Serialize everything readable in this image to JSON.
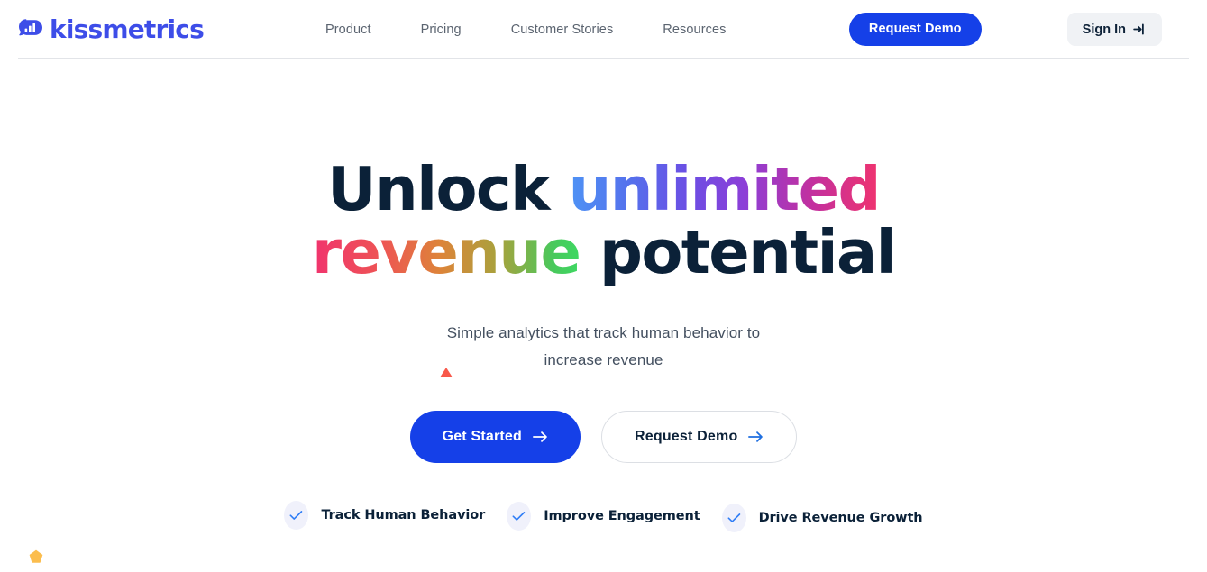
{
  "header": {
    "brand": {
      "name": "kissmetrics",
      "icon": "bar-chart-cloud-logo-icon",
      "color": "#3d4de8"
    },
    "nav": [
      {
        "label": "Product"
      },
      {
        "label": "Pricing"
      },
      {
        "label": "Customer Stories"
      },
      {
        "label": "Resources"
      }
    ],
    "request_demo_label": "Request Demo",
    "sign_in_label": "Sign In",
    "sign_in_icon": "sign-in-arrow-icon"
  },
  "hero": {
    "title_line1_plain": "Unlock ",
    "title_line1_gradient": "unlimited",
    "title_line2_gradient": "revenue",
    "title_line2_plain": " potential",
    "subtitle_line1": "Simple analytics that track human behavior to",
    "subtitle_line2": "increase revenue",
    "cta_primary": "Get Started",
    "cta_secondary": "Request Demo",
    "cta_arrow_icon": "arrow-right-icon"
  },
  "features": [
    {
      "label": "Track Human Behavior",
      "icon": "check-icon"
    },
    {
      "label": "Improve Engagement",
      "icon": "check-icon"
    },
    {
      "label": "Drive Revenue Growth",
      "icon": "check-icon"
    }
  ],
  "decorations": {
    "triangle": {
      "shape": "triangle-up",
      "color": "#f8584a"
    },
    "pentagon": {
      "shape": "pentagon",
      "color": "#fbbd4e"
    }
  },
  "colors": {
    "brand_blue": "#1540e8",
    "dark_navy": "#0b2138",
    "muted_gray": "#5b6470",
    "chip_bg": "#f0f2f5",
    "check_bg": "#f0f1fb",
    "check_blue": "#2f7df6"
  }
}
